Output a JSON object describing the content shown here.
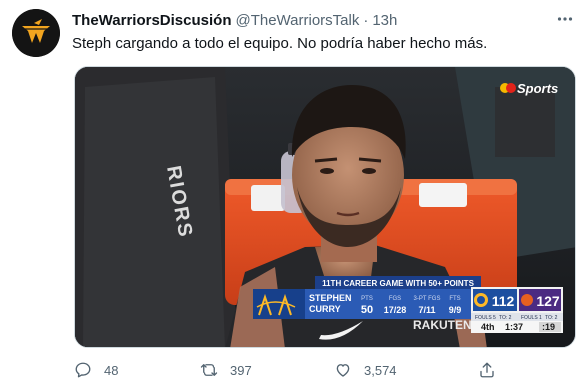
{
  "tweet": {
    "display_name": "TheWarriorsDiscusión",
    "handle": "@TheWarriorsTalk",
    "separator": "·",
    "time": "13h",
    "text": "Steph cargando a todo el equipo. No podría haber hecho más.",
    "avatar_icon": "warriors-logo-icon"
  },
  "media": {
    "network_logo": "Sports",
    "jersey_text": "RIORS",
    "shirt_text": "RAKUTEN",
    "scoreboard": {
      "banner": "11TH CAREER GAME WITH 50+ POINTS",
      "player_first": "STEPHEN",
      "player_last": "CURRY",
      "stats": [
        {
          "label": "PTS",
          "value": "50"
        },
        {
          "label": "FGS",
          "value": "17/28"
        },
        {
          "label": "3-PT FGS",
          "value": "7/11"
        },
        {
          "label": "FTS",
          "value": "9/9"
        }
      ],
      "home_score": "112",
      "away_score": "127",
      "home_fouls": "FOULS 5",
      "home_to": "TO: 2",
      "away_fouls": "FOULS 1",
      "away_to": "TO: 2",
      "quarter": "4th",
      "clock": "1:37",
      "shot_clock": ":19"
    }
  },
  "actions": {
    "replies": "48",
    "retweets": "397",
    "likes": "3,574"
  },
  "colors": {
    "accent_blue": "#1d4fa0",
    "warriors_gold": "#fdb927",
    "suns_purple": "#4b2b82",
    "suns_orange": "#e56020",
    "muted": "#536471"
  }
}
